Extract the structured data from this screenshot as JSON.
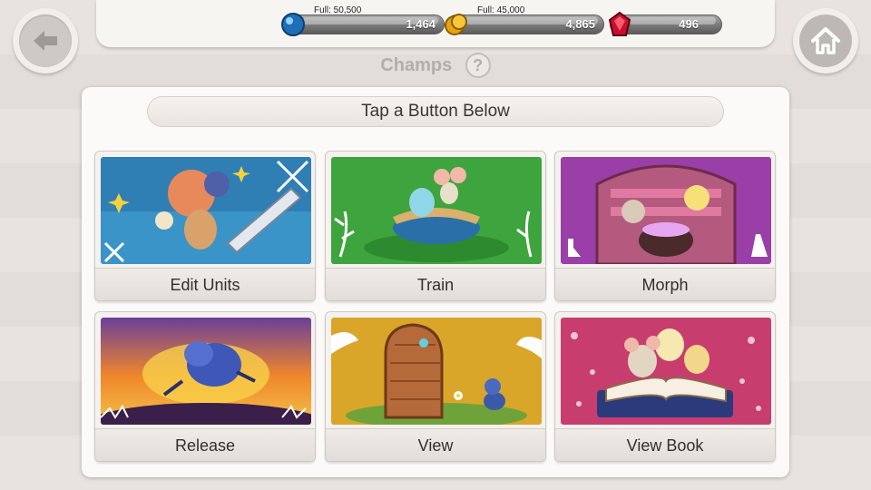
{
  "resources": {
    "water": {
      "full_label": "Full: 50,500",
      "value": "1,464",
      "icon": "blue-orb-icon",
      "color": "#2a8ed6"
    },
    "gold": {
      "full_label": "Full: 45,000",
      "value": "4,865",
      "icon": "gold-coin-icon",
      "color": "#e0a21a"
    },
    "ruby": {
      "value": "496",
      "icon": "red-gem-icon",
      "color": "#c8102e"
    }
  },
  "nav": {
    "back_icon": "back-arrow-icon",
    "home_icon": "home-icon"
  },
  "header": {
    "title": "Champs",
    "help_label": "?"
  },
  "instruction": "Tap a Button Below",
  "menu": [
    {
      "id": "edit",
      "label": "Edit Units",
      "art": "edit-units-artwork",
      "color": "#2f7fb5"
    },
    {
      "id": "train",
      "label": "Train",
      "art": "train-artwork",
      "color": "#3ea43e"
    },
    {
      "id": "morph",
      "label": "Morph",
      "art": "morph-artwork",
      "color": "#9a3fa8"
    },
    {
      "id": "release",
      "label": "Release",
      "art": "release-artwork",
      "color": "#f08b2a"
    },
    {
      "id": "view",
      "label": "View",
      "art": "view-artwork",
      "color": "#d9a62a"
    },
    {
      "id": "book",
      "label": "View Book",
      "art": "view-book-artwork",
      "color": "#c73d6e"
    }
  ]
}
